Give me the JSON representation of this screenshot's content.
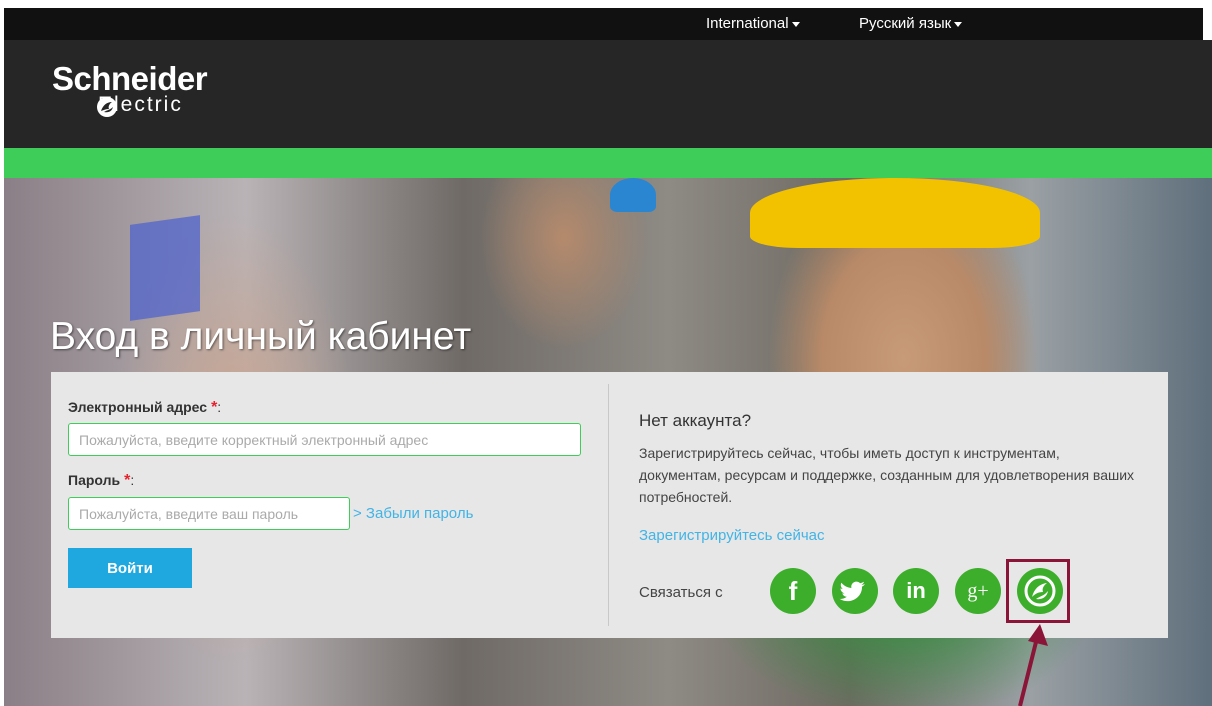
{
  "topbar": {
    "region_label": "International",
    "language_label": "Русский язык"
  },
  "logo": {
    "line1": "Schneider",
    "line2": "Electric"
  },
  "hero": {
    "title": "Вход в личный кабинет"
  },
  "login": {
    "email_label": "Электронный адрес",
    "email_placeholder": "Пожалуйста, введите корректный электронный адрес",
    "password_label": "Пароль",
    "password_placeholder": "Пожалуйста, введите ваш пароль",
    "required_mark": "*",
    "colon": ":",
    "forgot_password": "> Забыли пароль",
    "submit_label": "Войти"
  },
  "register": {
    "heading": "Нет аккаунта?",
    "description": "Зарегистрируйтесь сейчас, чтобы иметь доступ к инструментам, документам, ресурсам и поддержке, созданным для удовлетворения ваших потребностей.",
    "link": "Зарегистрируйтесь сейчас",
    "connect_label": "Связаться с"
  },
  "social": {
    "facebook": "f",
    "linkedin": "in",
    "googleplus": "g+"
  },
  "colors": {
    "brand_green": "#3dcd58",
    "link_blue": "#42b4e6",
    "button_blue": "#1fa7e0",
    "required_red": "#e5232f",
    "highlight": "#8b1538"
  }
}
